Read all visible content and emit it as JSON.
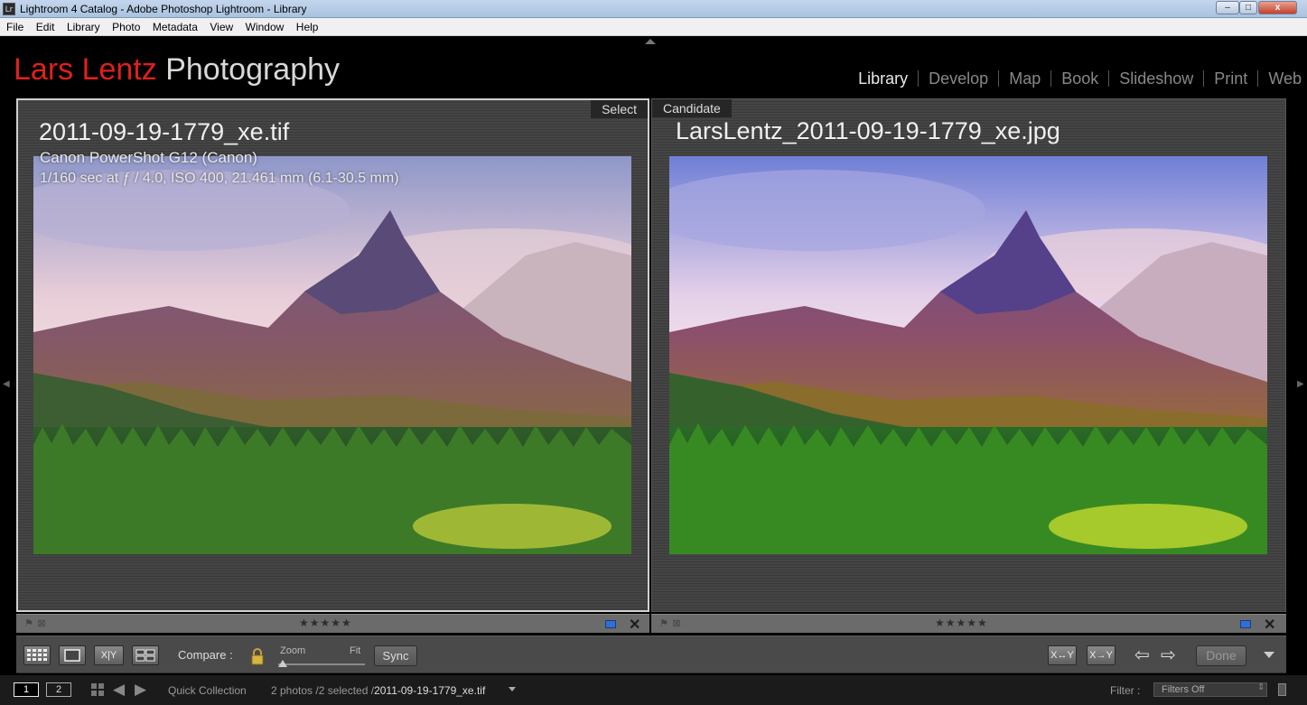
{
  "window": {
    "app_icon": "Lr",
    "title": "Lightroom 4 Catalog - Adobe Photoshop Lightroom - Library",
    "minimize": "–",
    "maximize": "□",
    "close": "x"
  },
  "menu": [
    "File",
    "Edit",
    "Library",
    "Photo",
    "Metadata",
    "View",
    "Window",
    "Help"
  ],
  "identity_plate": {
    "first": "Lars Lentz",
    "second": "Photography",
    "accent_color": "#e0201c"
  },
  "modules": [
    {
      "label": "Library",
      "active": true
    },
    {
      "label": "Develop",
      "active": false
    },
    {
      "label": "Map",
      "active": false
    },
    {
      "label": "Book",
      "active": false
    },
    {
      "label": "Slideshow",
      "active": false
    },
    {
      "label": "Print",
      "active": false
    },
    {
      "label": "Web",
      "active": false
    }
  ],
  "select_pane": {
    "tag": "Select",
    "filename": "2011-09-19-1779_xe.tif",
    "camera": "Canon PowerShot G12 (Canon)",
    "exposure": "1/160 sec at ƒ / 4.0, ISO 400, 21.461 mm (6.1-30.5 mm)",
    "rating_stars": "★★★★★",
    "color_label": "#2f6fd6",
    "close": "✕"
  },
  "candidate_pane": {
    "tag": "Candidate",
    "filename": "LarsLentz_2011-09-19-1779_xe.jpg",
    "rating_stars": "★★★★★",
    "color_label": "#2f6fd6",
    "close": "✕"
  },
  "toolbar": {
    "xy_label": "X|Y",
    "compare_label": "Compare :",
    "zoom_label": "Zoom",
    "fit_label": "Fit",
    "sync_label": "Sync",
    "swap_label": "X↔Y",
    "make_select_label": "X→Y",
    "done_label": "Done",
    "prev_arrow": "⇦",
    "next_arrow": "⇨"
  },
  "filmstrip_bar": {
    "page1": "1",
    "page2": "2",
    "prev": "◀",
    "next": "▶",
    "source": "Quick Collection",
    "count": "2 photos /2 selected /",
    "current_file": "2011-09-19-1779_xe.tif",
    "filter_label": "Filter :",
    "filter_value": "Filters Off"
  }
}
